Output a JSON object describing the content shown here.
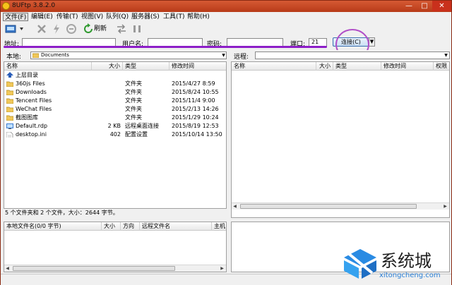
{
  "window": {
    "title": "8UFtp 3.8.2.0",
    "minimize": "—",
    "maximize": "□",
    "close": "✕"
  },
  "menu": [
    "文件(F)",
    "编辑(E)",
    "传输(T)",
    "视图(V)",
    "队列(Q)",
    "服务器(S)",
    "工具(T)",
    "帮助(H)"
  ],
  "toolbar": {
    "refresh": "刷新"
  },
  "connection": {
    "address_label": "地址:",
    "address_value": "",
    "user_label": "用户名:",
    "user_value": "",
    "password_label": "密码:",
    "password_value": "",
    "port_label": "端口:",
    "port_value": "21",
    "connect_label": "连接(C)"
  },
  "local": {
    "path_label": "本地:",
    "path_value": "Documents",
    "columns": [
      "名称",
      "大小",
      "类型",
      "修改时间"
    ],
    "files": [
      {
        "name": "上层目录",
        "size": "",
        "type": "",
        "modified": "",
        "icon": "up-dir-icon"
      },
      {
        "name": "360js Files",
        "size": "",
        "type": "文件夹",
        "modified": "2015/4/27 8:59",
        "icon": "folder-icon"
      },
      {
        "name": "Downloads",
        "size": "",
        "type": "文件夹",
        "modified": "2015/8/24 10:55",
        "icon": "folder-icon"
      },
      {
        "name": "Tencent Files",
        "size": "",
        "type": "文件夹",
        "modified": "2015/11/4 9:00",
        "icon": "folder-icon"
      },
      {
        "name": "WeChat Files",
        "size": "",
        "type": "文件夹",
        "modified": "2015/2/13 14:26",
        "icon": "folder-icon"
      },
      {
        "name": "截图图库",
        "size": "",
        "type": "文件夹",
        "modified": "2015/1/29 10:24",
        "icon": "folder-icon"
      },
      {
        "name": "Default.rdp",
        "size": "2 KB",
        "type": "远程桌面连接",
        "modified": "2015/8/19 12:53",
        "icon": "rdp-file-icon"
      },
      {
        "name": "desktop.ini",
        "size": "402",
        "type": "配置设置",
        "modified": "2015/10/14 13:50",
        "icon": "ini-file-icon"
      }
    ],
    "status": "5 个文件夹和 2 个文件，大小：2644 字节。"
  },
  "remote": {
    "path_label": "远程:",
    "path_value": "",
    "columns": [
      "名称",
      "大小",
      "类型",
      "修改时间",
      "权限"
    ]
  },
  "queue": {
    "columns": [
      "本地文件名(0/0 字节)",
      "大小",
      "方向",
      "远程文件名",
      "主机"
    ]
  },
  "watermark": {
    "brand": "系统城",
    "site": "xitongcheng.com"
  },
  "colors": {
    "annotation": "#8d1fc8",
    "titlebar": "#c84a25",
    "folder": "#f1c85a"
  }
}
